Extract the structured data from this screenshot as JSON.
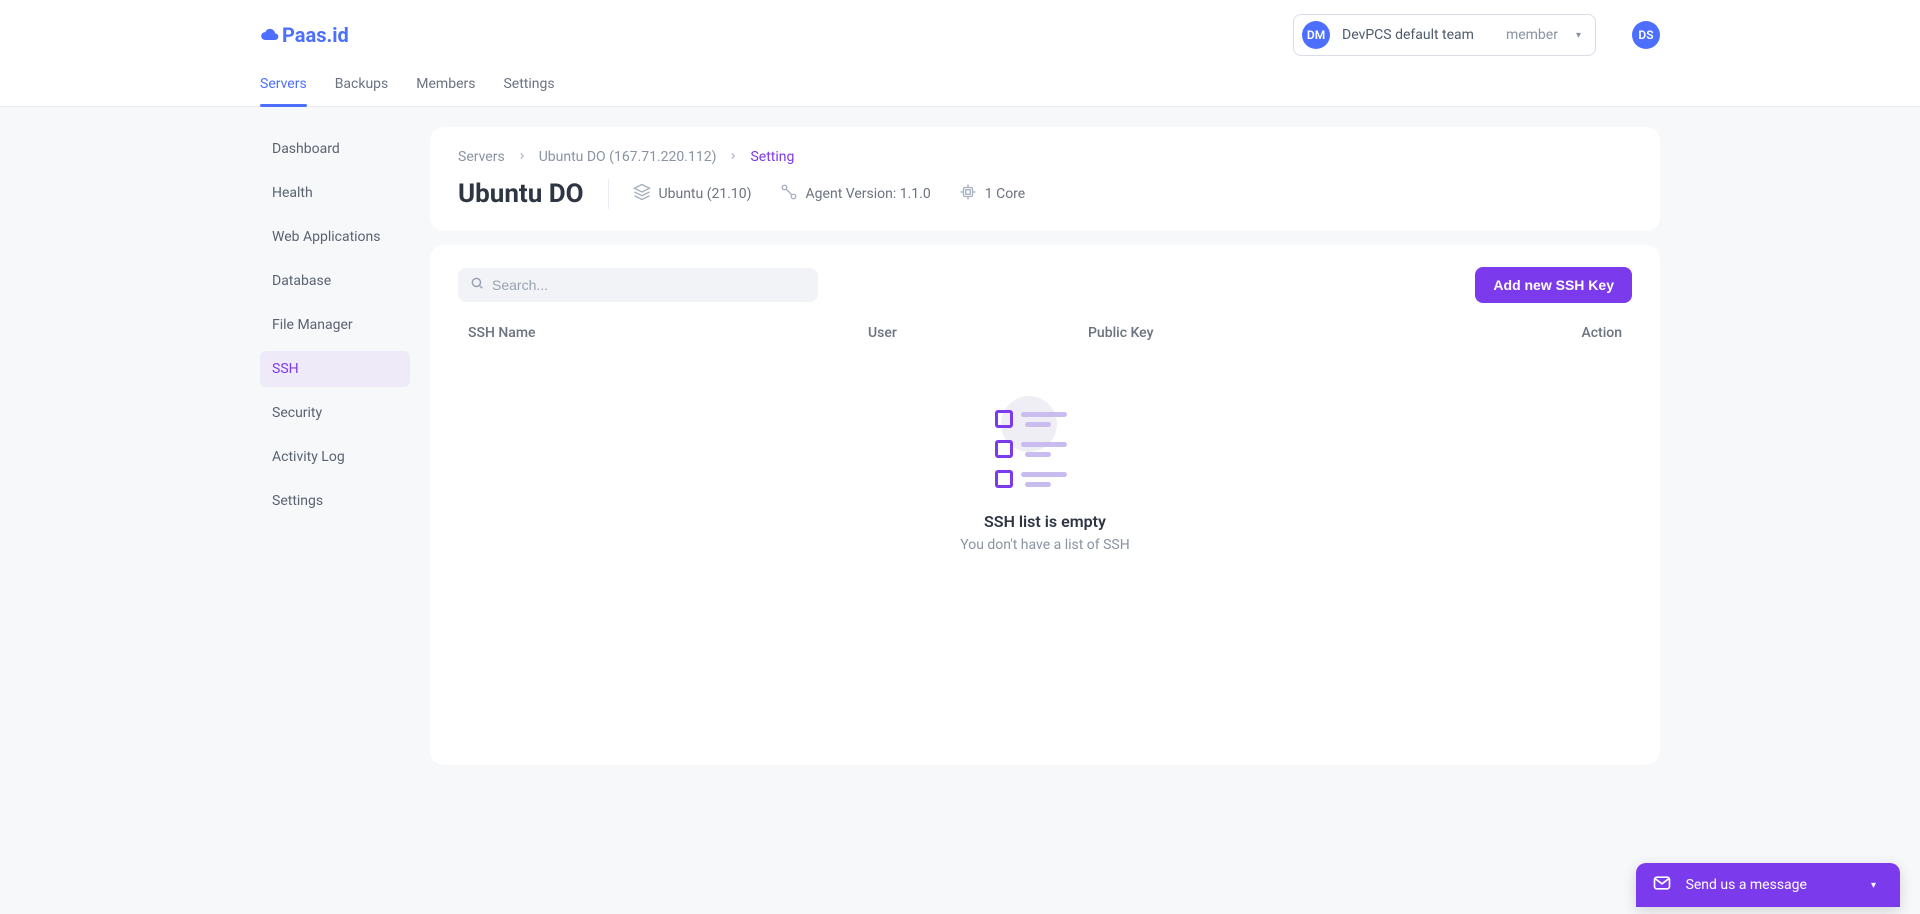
{
  "logo_text": "Paas.id",
  "team": {
    "avatar": "DM",
    "name": "DevPCS default team",
    "role": "member"
  },
  "user": {
    "avatar": "DS"
  },
  "topnav": {
    "items": [
      {
        "label": "Servers",
        "active": true
      },
      {
        "label": "Backups"
      },
      {
        "label": "Members"
      },
      {
        "label": "Settings"
      }
    ]
  },
  "sidebar": {
    "items": [
      {
        "label": "Dashboard"
      },
      {
        "label": "Health"
      },
      {
        "label": "Web Applications"
      },
      {
        "label": "Database"
      },
      {
        "label": "File Manager"
      },
      {
        "label": "SSH",
        "active": true
      },
      {
        "label": "Security"
      },
      {
        "label": "Activity Log"
      },
      {
        "label": "Settings"
      }
    ]
  },
  "breadcrumb": {
    "root": "Servers",
    "server": "Ubuntu DO (167.71.220.112)",
    "current": "Setting"
  },
  "header": {
    "title": "Ubuntu DO",
    "os": "Ubuntu (21.10)",
    "agent": "Agent Version: 1.1.0",
    "cores": "1 Core"
  },
  "list": {
    "search_placeholder": "Search...",
    "add_button": "Add new SSH Key",
    "columns": {
      "name": "SSH Name",
      "user": "User",
      "key": "Public Key",
      "action": "Action"
    },
    "empty": {
      "title": "SSH list is empty",
      "subtitle": "You don't have a list of SSH"
    }
  },
  "chat": {
    "label": "Send us a message"
  }
}
